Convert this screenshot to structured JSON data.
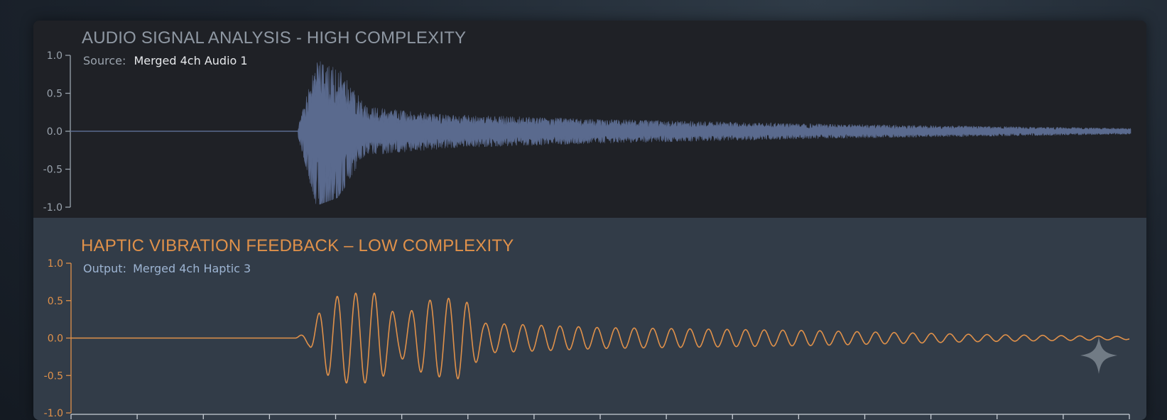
{
  "colors": {
    "audio_wave": "#5a6a8e",
    "haptic_wave": "#e0914a",
    "audio_title": "#8f98a3",
    "haptic_title": "#e0914a",
    "audio_axis": "#9aa3ad",
    "haptic_axis": "#e0914a",
    "haptic_subtitle": "#9db4d2"
  },
  "icons": [
    "sparkle-icon"
  ],
  "chart_data": [
    {
      "type": "line",
      "title": "AUDIO SIGNAL ANALYSIS - HIGH COMPLEXITY",
      "subtitle_key": "Source:",
      "subtitle_value": "Merged 4ch Audio 1",
      "ylim": [
        -1.0,
        1.0
      ],
      "xlim": [
        0,
        1
      ],
      "yticks": [
        "1.0",
        "0.5",
        "0.0",
        "-0.5",
        "-1.0"
      ],
      "ytick_values": [
        1.0,
        0.5,
        0.0,
        -0.5,
        -1.0
      ],
      "series": [
        {
          "signal": "dense noise burst",
          "onset_x": 0.215,
          "peak_amplitude": 0.95,
          "min_amplitude": -0.98,
          "envelope": [
            {
              "x": 0.215,
              "a": 0.08
            },
            {
              "x": 0.232,
              "a": 0.95
            },
            {
              "x": 0.252,
              "a": 0.85
            },
            {
              "x": 0.28,
              "a": 0.32
            },
            {
              "x": 0.36,
              "a": 0.22
            },
            {
              "x": 0.5,
              "a": 0.16
            },
            {
              "x": 0.7,
              "a": 0.1
            },
            {
              "x": 1.0,
              "a": 0.04
            }
          ]
        }
      ],
      "grid": false
    },
    {
      "type": "line",
      "title": "HAPTIC VIBRATION FEEDBACK – LOW COMPLEXITY",
      "subtitle_key": "Output:",
      "subtitle_value": "Merged 4ch Haptic 3",
      "ylim": [
        -1.0,
        1.0
      ],
      "xlim": [
        0,
        1
      ],
      "yticks": [
        "1.0",
        "0.5",
        "0.0",
        "-0.5",
        "-1.0"
      ],
      "ytick_values": [
        1.0,
        0.5,
        0.0,
        -0.5,
        -1.0
      ],
      "x_tick_count": 17,
      "series": [
        {
          "signal": "decaying sinusoid",
          "onset_x": 0.212,
          "cycles_per_unit": 57,
          "peak_amplitude": 0.6,
          "envelope": [
            {
              "x": 0.212,
              "a": 0.0
            },
            {
              "x": 0.225,
              "a": 0.1
            },
            {
              "x": 0.24,
              "a": 0.48
            },
            {
              "x": 0.258,
              "a": 0.6
            },
            {
              "x": 0.29,
              "a": 0.6
            },
            {
              "x": 0.31,
              "a": 0.25
            },
            {
              "x": 0.335,
              "a": 0.5
            },
            {
              "x": 0.37,
              "a": 0.55
            },
            {
              "x": 0.39,
              "a": 0.2
            },
            {
              "x": 0.5,
              "a": 0.14
            },
            {
              "x": 0.7,
              "a": 0.1
            },
            {
              "x": 0.85,
              "a": 0.05
            },
            {
              "x": 1.0,
              "a": 0.02
            }
          ]
        }
      ],
      "grid": false
    }
  ]
}
